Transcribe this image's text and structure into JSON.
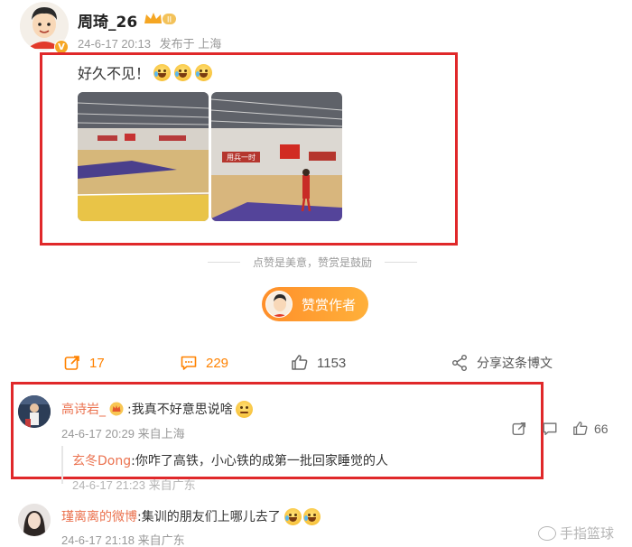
{
  "post": {
    "author": "周琦_26",
    "date": "24-6-17 20:13",
    "location": "发布于 上海",
    "text": "好久不见！",
    "tip": "点赞是美意，赞赏是鼓励",
    "reward_button": "赞赏作者",
    "photo2_banner": "用兵一时"
  },
  "actions": {
    "repost_count": "17",
    "comment_count": "229",
    "like_count": "1153",
    "share_label": "分享这条博文"
  },
  "comments": [
    {
      "name": "高诗岩_",
      "text": ":我真不好意思说啥",
      "date": "24-6-17 20:29",
      "location": "来自上海",
      "like_count": "66",
      "reply": {
        "name": "玄冬Dong",
        "text": ":你咋了高铁，小心铁的成第一批回家睡觉的人",
        "meta": "24-6-17 21:23 来自广东"
      }
    },
    {
      "name": "瑾离离的微博",
      "text": ":集训的朋友们上哪儿去了",
      "date": "24-6-17 21:18",
      "location": "来自广东"
    }
  ],
  "watermark": "手指篮球",
  "colors": {
    "accent": "#ff8200",
    "name": "#eb7350",
    "highlight": "#e0282a"
  }
}
